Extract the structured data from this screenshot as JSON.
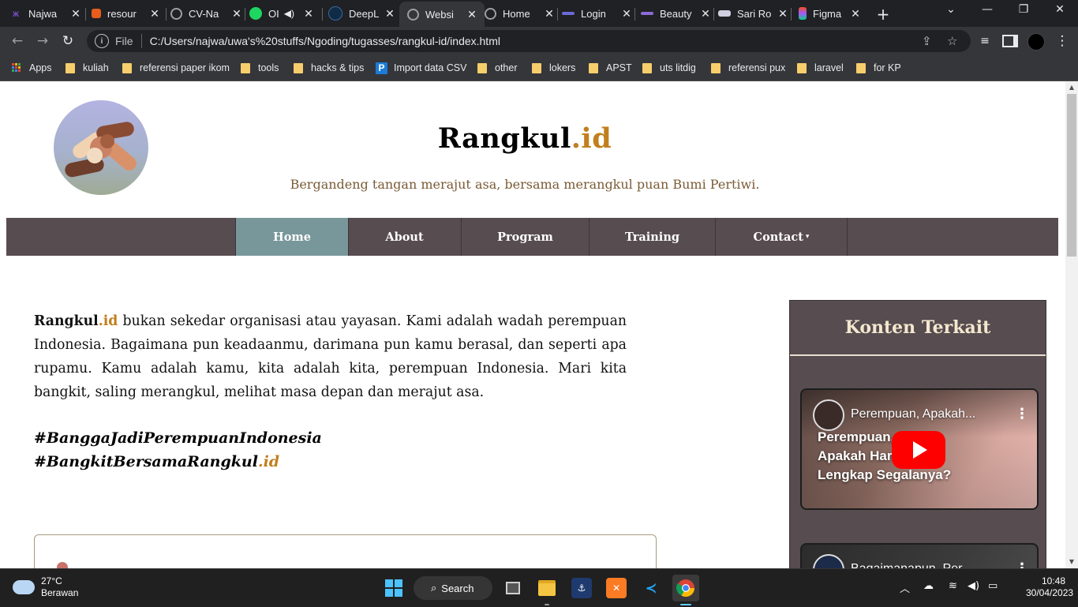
{
  "browser": {
    "tabs": [
      {
        "label": "Najwa",
        "icon": "butterfly-icon",
        "color": "#8b5cf6"
      },
      {
        "label": "resour",
        "icon": "stackedit-icon",
        "color": "#e85d1c"
      },
      {
        "label": "CV-Na",
        "icon": "globe-icon",
        "color": "#9aa0a6"
      },
      {
        "label": "OI",
        "icon": "spotify-icon",
        "color": "#1ed760"
      },
      {
        "label": "DeepL",
        "icon": "deepl-icon",
        "color": "#0f2b46"
      },
      {
        "label": "Websi",
        "icon": "globe-icon",
        "color": "#9aa0a6"
      },
      {
        "label": "Home",
        "icon": "globe-icon",
        "color": "#9aa0a6"
      },
      {
        "label": "Login",
        "icon": "logo-icon",
        "color": "#6b6bd6"
      },
      {
        "label": "Beauty",
        "icon": "logo-icon",
        "color": "#8a6bd6"
      },
      {
        "label": "Sari Ro",
        "icon": "flag-icon",
        "color": "#cfcfe0"
      },
      {
        "label": "Figma",
        "icon": "figma-icon",
        "color": "#f24e1e"
      }
    ],
    "active_tab_index": 5,
    "close_glyph": "✕",
    "new_tab_glyph": "+",
    "tab_list_glyph": "⌄",
    "minimize_glyph": "—",
    "restore_glyph": "❐",
    "close_window_glyph": "✕",
    "back_glyph": "←",
    "forward_glyph": "→",
    "reload_glyph": "↻",
    "file_label": "File",
    "url": "C:/Users/najwa/uwa's%20stuffs/Ngoding/tugasses/rangkul-id/index.html",
    "bookmarks": [
      {
        "label": "Apps",
        "icon": "apps-grid-icon"
      },
      {
        "label": "kuliah",
        "icon": "folder-icon"
      },
      {
        "label": "referensi paper ikom",
        "icon": "folder-icon"
      },
      {
        "label": "tools",
        "icon": "folder-icon"
      },
      {
        "label": "hacks & tips",
        "icon": "folder-icon"
      },
      {
        "label": "Import data CSV",
        "icon": "p-icon"
      },
      {
        "label": "other",
        "icon": "folder-icon"
      },
      {
        "label": "lokers",
        "icon": "folder-icon"
      },
      {
        "label": "APST",
        "icon": "folder-icon"
      },
      {
        "label": "uts litdig",
        "icon": "folder-icon"
      },
      {
        "label": "referensi pux",
        "icon": "folder-icon"
      },
      {
        "label": "laravel",
        "icon": "folder-icon"
      },
      {
        "label": "for KP",
        "icon": "folder-icon"
      }
    ]
  },
  "site": {
    "brand_main": "Rangkul",
    "brand_accent": ".id",
    "tagline": "Bergandeng tangan merajut asa, bersama merangkul puan Bumi Pertiwi.",
    "accent_color": "#c17f1e",
    "nav_color": "#574c4f",
    "nav_active_color": "#78979b",
    "nav": [
      {
        "label": "Home",
        "active": true
      },
      {
        "label": "About"
      },
      {
        "label": "Program"
      },
      {
        "label": "Training"
      },
      {
        "label": "Contact",
        "caret": "▾"
      }
    ],
    "intro_brand_main": "Rangkul",
    "intro_brand_accent": ".id",
    "intro_text": " bukan sekedar organisasi atau yayasan. Kami adalah wadah perempuan Indonesia. Bagaimana pun keadaanmu, darimana pun kamu berasal, dan seperti apa rupamu. Kamu adalah kamu, kita adalah kita, perempuan Indonesia. Mari kita bangkit, saling merangkul, melihat masa depan dan merajut asa.",
    "hashtag1": "#BanggaJadiPerempuanIndonesia",
    "hashtag2_main": "#BangkitBersamaRangkul",
    "hashtag2_accent": ".id",
    "sidebar": {
      "title": "Konten Terkait",
      "videos": [
        {
          "title": "Perempuan, Apakah...",
          "caption_lines": [
            "Perempuan,",
            "Apakah Harus",
            "Lengkap Segalanya?"
          ],
          "menu_glyph": "⋮"
        },
        {
          "title": "Bagaimanapun, Per...",
          "menu_glyph": "⋮"
        }
      ]
    }
  },
  "taskbar": {
    "weather_temp": "27°C",
    "weather_desc": "Berawan",
    "search_label": "Search",
    "time": "10:48",
    "date": "30/04/2023",
    "tray_chevron": "︿"
  }
}
